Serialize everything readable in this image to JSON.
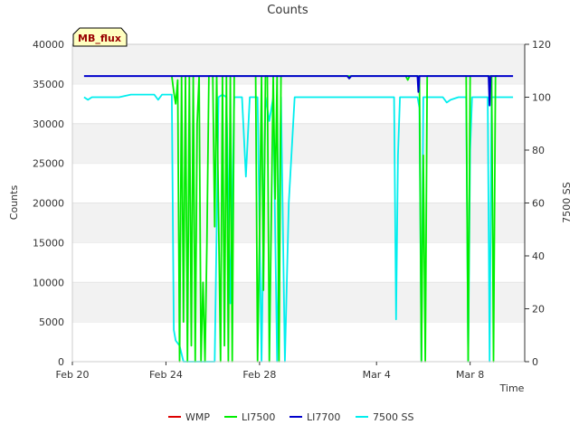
{
  "chart_data": {
    "type": "line",
    "title": "Counts",
    "site_tag": "MB_flux",
    "xlabel": "Time",
    "ylabel": "Counts",
    "y2label": "7500 SS",
    "xlim": [
      "2024-02-20",
      "2024-03-10T08:00"
    ],
    "ylim": [
      0,
      40000
    ],
    "y2lim": [
      0,
      120
    ],
    "x_tick_labels": [
      {
        "date": "2024-02-20",
        "label": "Feb 20"
      },
      {
        "date": "2024-02-24",
        "label": "Feb 24"
      },
      {
        "date": "2024-02-28",
        "label": "Feb 28"
      },
      {
        "date": "2024-03-04",
        "label": "Mar 4"
      },
      {
        "date": "2024-03-08",
        "label": "Mar 8"
      }
    ],
    "y_ticks": [
      0,
      5000,
      10000,
      15000,
      20000,
      25000,
      30000,
      35000,
      40000
    ],
    "y2_ticks": [
      0,
      20,
      40,
      60,
      80,
      100,
      120
    ],
    "grid": "horizontal bands",
    "legend_position": "bottom",
    "colors": {
      "WMP": "#dd0000",
      "LI7500": "#00ee00",
      "LI7700": "#0000cc",
      "7500 SS": "#00eeee"
    },
    "series": [
      {
        "name": "WMP",
        "axis": "left",
        "x": [],
        "values": []
      },
      {
        "name": "LI7700",
        "axis": "left",
        "x": [
          "2024-02-20T12:00",
          "2024-02-23T12:00",
          "2024-02-27T00:00",
          "2024-03-02T18:00",
          "2024-03-02T20:00",
          "2024-03-02T22:00",
          "2024-03-05T00:00",
          "2024-03-05T18:00",
          "2024-03-05T19:00",
          "2024-03-05T20:00",
          "2024-03-07T12:00",
          "2024-03-08T19:00",
          "2024-03-08T20:00",
          "2024-03-08T21:00",
          "2024-03-09T20:00"
        ],
        "values": [
          36000,
          36000,
          36000,
          36000,
          35700,
          36000,
          36000,
          36000,
          34000,
          36000,
          36000,
          36000,
          32300,
          36000,
          36000
        ]
      },
      {
        "name": "LI7500",
        "axis": "left",
        "x": [
          "2024-02-24T06:00",
          "2024-02-24T08:00",
          "2024-02-24T10:00",
          "2024-02-24T12:00",
          "2024-02-24T14:00",
          "2024-02-24T16:00",
          "2024-02-24T18:00",
          "2024-02-24T20:00",
          "2024-02-24T22:00",
          "2024-02-25T00:00",
          "2024-02-25T02:00",
          "2024-02-25T04:00",
          "2024-02-25T06:00",
          "2024-02-25T08:00",
          "2024-02-25T10:00",
          "2024-02-25T12:00",
          "2024-02-25T14:00",
          "2024-02-25T16:00",
          "2024-02-25T18:00",
          "2024-02-25T20:00",
          "2024-02-25T22:00",
          "2024-02-26T00:00",
          "2024-02-26T02:00",
          "2024-02-26T04:00",
          "2024-02-26T08:00",
          "2024-02-26T10:00",
          "2024-02-26T12:00",
          "2024-02-26T14:00",
          "2024-02-26T16:00",
          "2024-02-26T18:00",
          "2024-02-26T20:00",
          "2024-02-26T22:00",
          "2024-02-27T02:00",
          "2024-02-27T20:00",
          "2024-02-27T22:00",
          "2024-02-28T00:00",
          "2024-02-28T02:00",
          "2024-02-28T04:00",
          "2024-02-28T06:00",
          "2024-02-28T08:00",
          "2024-02-28T10:00",
          "2024-02-28T14:00",
          "2024-02-28T16:00",
          "2024-02-28T18:00",
          "2024-02-28T20:00",
          "2024-02-28T22:00",
          "2024-02-29T00:00",
          "2024-02-29T02:00",
          "2024-02-29T04:00",
          "2024-02-29T06:00",
          "2024-03-05T06:00",
          "2024-03-05T08:00",
          "2024-03-05T10:00",
          "2024-03-05T20:00",
          "2024-03-05T22:00",
          "2024-03-06T00:00",
          "2024-03-06T02:00",
          "2024-03-06T04:00",
          "2024-03-07T20:00",
          "2024-03-07T22:00",
          "2024-03-08T00:00",
          "2024-03-08T02:00",
          "2024-03-08T04:00",
          "2024-03-08T22:00",
          "2024-03-09T00:00",
          "2024-03-09T02:00",
          "2024-03-09T04:00"
        ],
        "values": [
          36000,
          34000,
          32500,
          35500,
          0,
          36000,
          5000,
          36000,
          0,
          36000,
          2000,
          36000,
          0,
          30000,
          36000,
          0,
          10000,
          0,
          15000,
          36000,
          36000,
          36000,
          17000,
          36000,
          0,
          36000,
          2000,
          36000,
          0,
          36000,
          0,
          36000,
          36000,
          36000,
          0,
          16000,
          36000,
          9000,
          36000,
          36000,
          0,
          36000,
          20500,
          36000,
          0,
          36000,
          36000,
          36000,
          36000,
          36000,
          36000,
          35500,
          36000,
          36000,
          0,
          26000,
          0,
          36000,
          36000,
          0,
          36000,
          36000,
          36000,
          36000,
          0,
          36000,
          36000
        ]
      },
      {
        "name": "7500 SS",
        "axis": "right",
        "x": [
          "2024-02-20T12:00",
          "2024-02-20T16:00",
          "2024-02-20T20:00",
          "2024-02-21T06:00",
          "2024-02-21T18:00",
          "2024-02-22T00:00",
          "2024-02-22T12:00",
          "2024-02-23T00:00",
          "2024-02-23T12:00",
          "2024-02-23T16:00",
          "2024-02-23T20:00",
          "2024-02-24T00:00",
          "2024-02-24T06:00",
          "2024-02-24T08:00",
          "2024-02-24T10:00",
          "2024-02-24T14:00",
          "2024-02-24T18:00",
          "2024-02-24T22:00",
          "2024-02-25T02:00",
          "2024-02-25T06:00",
          "2024-02-25T10:00",
          "2024-02-25T14:00",
          "2024-02-25T18:00",
          "2024-02-25T22:00",
          "2024-02-26T02:00",
          "2024-02-26T06:00",
          "2024-02-26T10:00",
          "2024-02-26T14:00",
          "2024-02-26T18:00",
          "2024-02-26T22:00",
          "2024-02-27T02:00",
          "2024-02-27T06:00",
          "2024-02-27T10:00",
          "2024-02-27T14:00",
          "2024-02-27T18:00",
          "2024-02-27T22:00",
          "2024-02-28T02:00",
          "2024-02-28T06:00",
          "2024-02-28T10:00",
          "2024-02-28T14:00",
          "2024-02-28T18:00",
          "2024-02-28T22:00",
          "2024-02-29T02:00",
          "2024-02-29T06:00",
          "2024-02-29T12:00",
          "2024-03-01T00:00",
          "2024-03-02T00:00",
          "2024-03-03T00:00",
          "2024-03-04T00:00",
          "2024-03-04T18:00",
          "2024-03-04T20:00",
          "2024-03-04T22:00",
          "2024-03-05T00:00",
          "2024-03-05T02:00",
          "2024-03-05T18:00",
          "2024-03-05T20:00",
          "2024-03-05T22:00",
          "2024-03-06T00:00",
          "2024-03-06T04:00",
          "2024-03-06T12:00",
          "2024-03-06T20:00",
          "2024-03-07T00:00",
          "2024-03-07T04:00",
          "2024-03-07T12:00",
          "2024-03-07T20:00",
          "2024-03-07T22:00",
          "2024-03-08T00:00",
          "2024-03-08T02:00",
          "2024-03-08T06:00",
          "2024-03-08T12:00",
          "2024-03-08T18:00",
          "2024-03-08T20:00",
          "2024-03-08T22:00",
          "2024-03-09T00:00",
          "2024-03-09T12:00",
          "2024-03-09T20:00"
        ],
        "values": [
          100,
          99,
          100,
          100,
          100,
          100,
          101,
          101,
          101,
          99,
          101,
          101,
          101,
          12,
          8,
          6,
          0,
          0,
          0,
          0,
          0,
          0,
          0,
          0,
          0,
          100,
          101,
          100,
          22,
          100,
          100,
          100,
          70,
          100,
          100,
          100,
          0,
          100,
          91,
          100,
          0,
          100,
          0,
          60,
          100,
          100,
          100,
          100,
          100,
          100,
          16,
          78,
          100,
          100,
          100,
          96,
          0,
          100,
          100,
          100,
          100,
          98,
          99,
          100,
          100,
          0,
          80,
          100,
          100,
          100,
          100,
          0,
          100,
          100,
          100,
          100
        ]
      }
    ]
  }
}
